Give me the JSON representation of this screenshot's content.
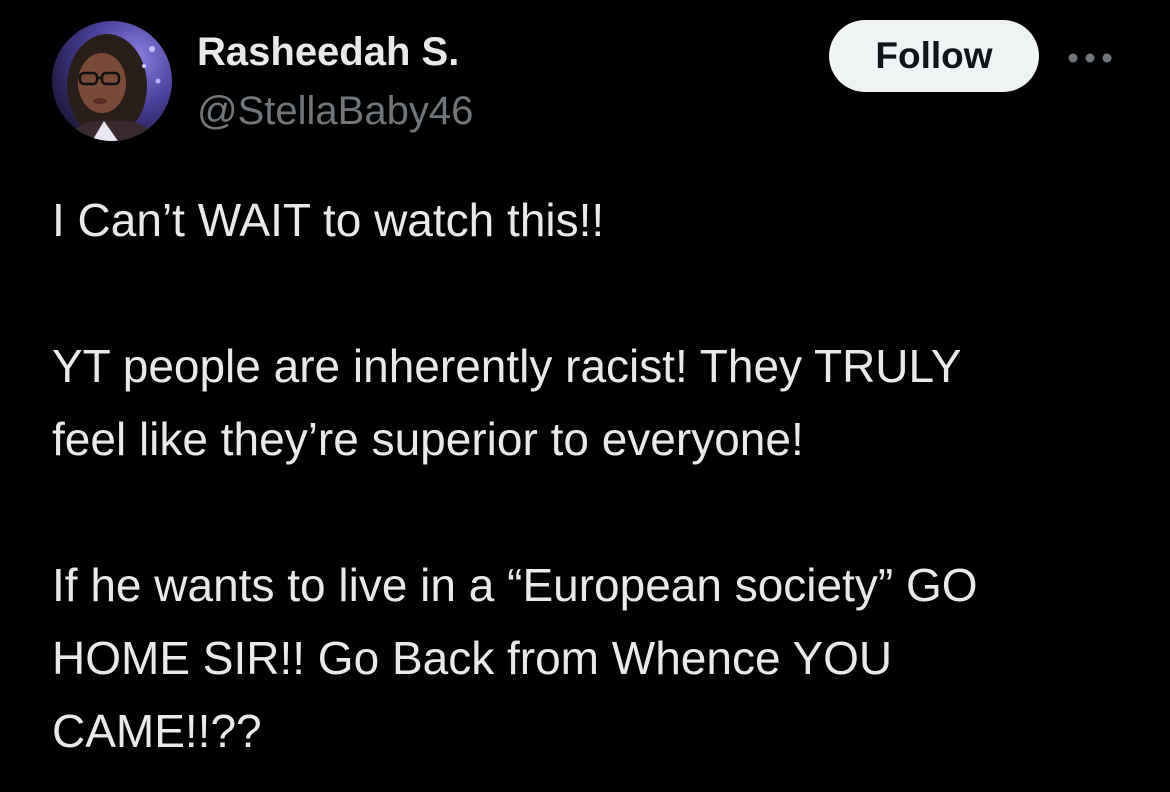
{
  "author": {
    "display_name": "Rasheedah S.",
    "handle": "@StellaBaby46"
  },
  "actions": {
    "follow_label": "Follow",
    "more_icon": "more-horizontal-icon"
  },
  "tweet": {
    "lines": [
      "I Can’t WAIT to watch this!!",
      "YT people are inherently racist! They TRULY",
      "feel like they’re superior to everyone!",
      "If he wants to live in a “European society” GO",
      "HOME SIR!! Go Back from Whence YOU",
      "CAME!!??"
    ]
  },
  "colors": {
    "background": "#000000",
    "primary_text": "#e7e9ea",
    "secondary_text": "#71767b",
    "follow_button_bg": "#eff3f4",
    "follow_button_text": "#0f1419"
  }
}
